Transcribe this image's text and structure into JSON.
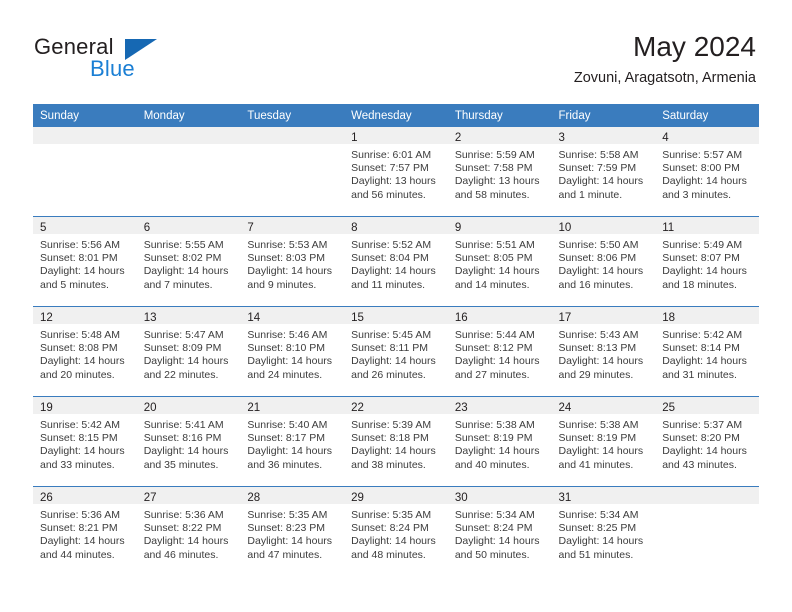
{
  "brand": {
    "name_top": "General",
    "name_bottom": "Blue",
    "triangle_color": "#1668b3",
    "blue_text_color": "#1b7fd4"
  },
  "header": {
    "title": "May 2024",
    "subtitle": "Zovuni, Aragatsotn, Armenia"
  },
  "colors": {
    "header_row_bg": "#3a7cbe",
    "header_row_text": "#ffffff",
    "daynum_band_bg": "#f0f0f0",
    "week_separator": "#3a7cbe",
    "body_text": "#3c3c3c"
  },
  "weekday_headers": [
    "Sunday",
    "Monday",
    "Tuesday",
    "Wednesday",
    "Thursday",
    "Friday",
    "Saturday"
  ],
  "weeks": [
    [
      {
        "day": "",
        "sunrise": "",
        "sunset": "",
        "daylight_line1": "",
        "daylight_line2": "",
        "empty": true
      },
      {
        "day": "",
        "sunrise": "",
        "sunset": "",
        "daylight_line1": "",
        "daylight_line2": "",
        "empty": true
      },
      {
        "day": "",
        "sunrise": "",
        "sunset": "",
        "daylight_line1": "",
        "daylight_line2": "",
        "empty": true
      },
      {
        "day": "1",
        "sunrise": "Sunrise: 6:01 AM",
        "sunset": "Sunset: 7:57 PM",
        "daylight_line1": "Daylight: 13 hours",
        "daylight_line2": "and 56 minutes.",
        "empty": false
      },
      {
        "day": "2",
        "sunrise": "Sunrise: 5:59 AM",
        "sunset": "Sunset: 7:58 PM",
        "daylight_line1": "Daylight: 13 hours",
        "daylight_line2": "and 58 minutes.",
        "empty": false
      },
      {
        "day": "3",
        "sunrise": "Sunrise: 5:58 AM",
        "sunset": "Sunset: 7:59 PM",
        "daylight_line1": "Daylight: 14 hours",
        "daylight_line2": "and 1 minute.",
        "empty": false
      },
      {
        "day": "4",
        "sunrise": "Sunrise: 5:57 AM",
        "sunset": "Sunset: 8:00 PM",
        "daylight_line1": "Daylight: 14 hours",
        "daylight_line2": "and 3 minutes.",
        "empty": false
      }
    ],
    [
      {
        "day": "5",
        "sunrise": "Sunrise: 5:56 AM",
        "sunset": "Sunset: 8:01 PM",
        "daylight_line1": "Daylight: 14 hours",
        "daylight_line2": "and 5 minutes.",
        "empty": false
      },
      {
        "day": "6",
        "sunrise": "Sunrise: 5:55 AM",
        "sunset": "Sunset: 8:02 PM",
        "daylight_line1": "Daylight: 14 hours",
        "daylight_line2": "and 7 minutes.",
        "empty": false
      },
      {
        "day": "7",
        "sunrise": "Sunrise: 5:53 AM",
        "sunset": "Sunset: 8:03 PM",
        "daylight_line1": "Daylight: 14 hours",
        "daylight_line2": "and 9 minutes.",
        "empty": false
      },
      {
        "day": "8",
        "sunrise": "Sunrise: 5:52 AM",
        "sunset": "Sunset: 8:04 PM",
        "daylight_line1": "Daylight: 14 hours",
        "daylight_line2": "and 11 minutes.",
        "empty": false
      },
      {
        "day": "9",
        "sunrise": "Sunrise: 5:51 AM",
        "sunset": "Sunset: 8:05 PM",
        "daylight_line1": "Daylight: 14 hours",
        "daylight_line2": "and 14 minutes.",
        "empty": false
      },
      {
        "day": "10",
        "sunrise": "Sunrise: 5:50 AM",
        "sunset": "Sunset: 8:06 PM",
        "daylight_line1": "Daylight: 14 hours",
        "daylight_line2": "and 16 minutes.",
        "empty": false
      },
      {
        "day": "11",
        "sunrise": "Sunrise: 5:49 AM",
        "sunset": "Sunset: 8:07 PM",
        "daylight_line1": "Daylight: 14 hours",
        "daylight_line2": "and 18 minutes.",
        "empty": false
      }
    ],
    [
      {
        "day": "12",
        "sunrise": "Sunrise: 5:48 AM",
        "sunset": "Sunset: 8:08 PM",
        "daylight_line1": "Daylight: 14 hours",
        "daylight_line2": "and 20 minutes.",
        "empty": false
      },
      {
        "day": "13",
        "sunrise": "Sunrise: 5:47 AM",
        "sunset": "Sunset: 8:09 PM",
        "daylight_line1": "Daylight: 14 hours",
        "daylight_line2": "and 22 minutes.",
        "empty": false
      },
      {
        "day": "14",
        "sunrise": "Sunrise: 5:46 AM",
        "sunset": "Sunset: 8:10 PM",
        "daylight_line1": "Daylight: 14 hours",
        "daylight_line2": "and 24 minutes.",
        "empty": false
      },
      {
        "day": "15",
        "sunrise": "Sunrise: 5:45 AM",
        "sunset": "Sunset: 8:11 PM",
        "daylight_line1": "Daylight: 14 hours",
        "daylight_line2": "and 26 minutes.",
        "empty": false
      },
      {
        "day": "16",
        "sunrise": "Sunrise: 5:44 AM",
        "sunset": "Sunset: 8:12 PM",
        "daylight_line1": "Daylight: 14 hours",
        "daylight_line2": "and 27 minutes.",
        "empty": false
      },
      {
        "day": "17",
        "sunrise": "Sunrise: 5:43 AM",
        "sunset": "Sunset: 8:13 PM",
        "daylight_line1": "Daylight: 14 hours",
        "daylight_line2": "and 29 minutes.",
        "empty": false
      },
      {
        "day": "18",
        "sunrise": "Sunrise: 5:42 AM",
        "sunset": "Sunset: 8:14 PM",
        "daylight_line1": "Daylight: 14 hours",
        "daylight_line2": "and 31 minutes.",
        "empty": false
      }
    ],
    [
      {
        "day": "19",
        "sunrise": "Sunrise: 5:42 AM",
        "sunset": "Sunset: 8:15 PM",
        "daylight_line1": "Daylight: 14 hours",
        "daylight_line2": "and 33 minutes.",
        "empty": false
      },
      {
        "day": "20",
        "sunrise": "Sunrise: 5:41 AM",
        "sunset": "Sunset: 8:16 PM",
        "daylight_line1": "Daylight: 14 hours",
        "daylight_line2": "and 35 minutes.",
        "empty": false
      },
      {
        "day": "21",
        "sunrise": "Sunrise: 5:40 AM",
        "sunset": "Sunset: 8:17 PM",
        "daylight_line1": "Daylight: 14 hours",
        "daylight_line2": "and 36 minutes.",
        "empty": false
      },
      {
        "day": "22",
        "sunrise": "Sunrise: 5:39 AM",
        "sunset": "Sunset: 8:18 PM",
        "daylight_line1": "Daylight: 14 hours",
        "daylight_line2": "and 38 minutes.",
        "empty": false
      },
      {
        "day": "23",
        "sunrise": "Sunrise: 5:38 AM",
        "sunset": "Sunset: 8:19 PM",
        "daylight_line1": "Daylight: 14 hours",
        "daylight_line2": "and 40 minutes.",
        "empty": false
      },
      {
        "day": "24",
        "sunrise": "Sunrise: 5:38 AM",
        "sunset": "Sunset: 8:19 PM",
        "daylight_line1": "Daylight: 14 hours",
        "daylight_line2": "and 41 minutes.",
        "empty": false
      },
      {
        "day": "25",
        "sunrise": "Sunrise: 5:37 AM",
        "sunset": "Sunset: 8:20 PM",
        "daylight_line1": "Daylight: 14 hours",
        "daylight_line2": "and 43 minutes.",
        "empty": false
      }
    ],
    [
      {
        "day": "26",
        "sunrise": "Sunrise: 5:36 AM",
        "sunset": "Sunset: 8:21 PM",
        "daylight_line1": "Daylight: 14 hours",
        "daylight_line2": "and 44 minutes.",
        "empty": false
      },
      {
        "day": "27",
        "sunrise": "Sunrise: 5:36 AM",
        "sunset": "Sunset: 8:22 PM",
        "daylight_line1": "Daylight: 14 hours",
        "daylight_line2": "and 46 minutes.",
        "empty": false
      },
      {
        "day": "28",
        "sunrise": "Sunrise: 5:35 AM",
        "sunset": "Sunset: 8:23 PM",
        "daylight_line1": "Daylight: 14 hours",
        "daylight_line2": "and 47 minutes.",
        "empty": false
      },
      {
        "day": "29",
        "sunrise": "Sunrise: 5:35 AM",
        "sunset": "Sunset: 8:24 PM",
        "daylight_line1": "Daylight: 14 hours",
        "daylight_line2": "and 48 minutes.",
        "empty": false
      },
      {
        "day": "30",
        "sunrise": "Sunrise: 5:34 AM",
        "sunset": "Sunset: 8:24 PM",
        "daylight_line1": "Daylight: 14 hours",
        "daylight_line2": "and 50 minutes.",
        "empty": false
      },
      {
        "day": "31",
        "sunrise": "Sunrise: 5:34 AM",
        "sunset": "Sunset: 8:25 PM",
        "daylight_line1": "Daylight: 14 hours",
        "daylight_line2": "and 51 minutes.",
        "empty": false
      },
      {
        "day": "",
        "sunrise": "",
        "sunset": "",
        "daylight_line1": "",
        "daylight_line2": "",
        "empty": true
      }
    ]
  ]
}
